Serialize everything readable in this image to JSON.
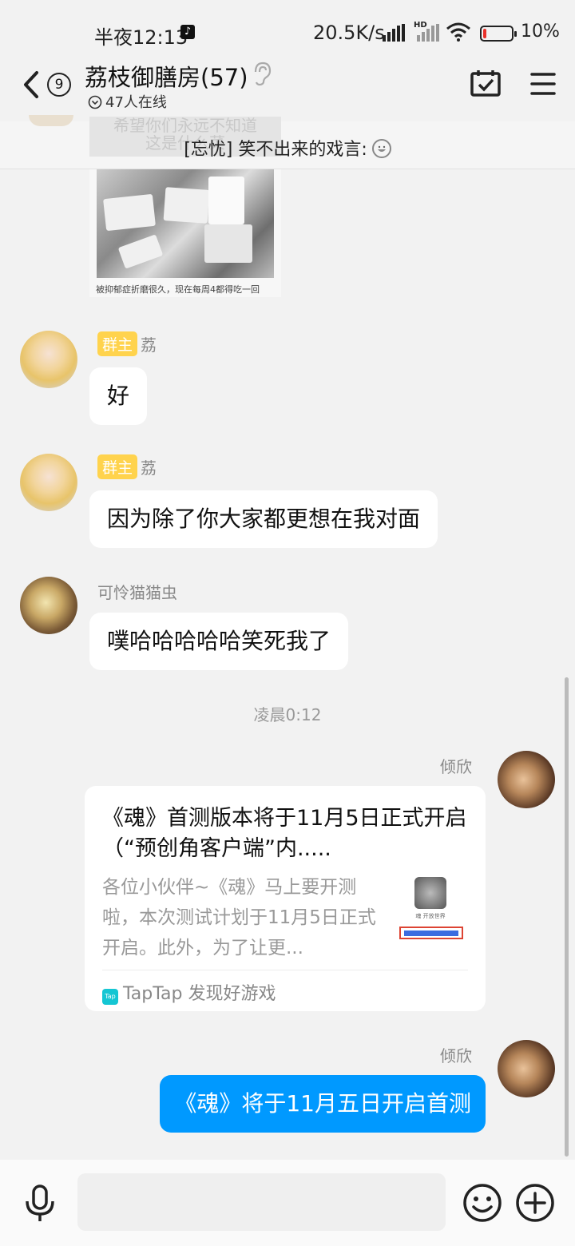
{
  "status_bar": {
    "time": "半夜12:13",
    "network_speed": "20.5K/s",
    "hd_label": "HD",
    "battery": "10%",
    "battery_level": 0.1
  },
  "header": {
    "back_count": "9",
    "group_name": "荔枝御膳房(57)",
    "online_count": "47人在线"
  },
  "pinned": {
    "text": "[忘忧] 笑不出来的戏言:",
    "ghost_text": "希望你们永远不知道\n这是什么菜"
  },
  "image_message": {
    "caption": "被抑郁症折磨很久，现在每周4都得吃一回"
  },
  "messages": [
    {
      "sender": "荔",
      "role": "群主",
      "text": "好"
    },
    {
      "sender": "荔",
      "role": "群主",
      "text": "因为除了你大家都更想在我对面"
    },
    {
      "sender": "可怜猫猫虫",
      "text": "噗哈哈哈哈哈笑死我了"
    }
  ],
  "timestamp": "凌晨0:12",
  "card_message": {
    "sender": "倾欣",
    "title": "《魂》首测版本将于11月5日正式开启（“预创角客户端”内.....",
    "description": "各位小伙伴~《魂》马上要开测啦，本次测试计划于11月5日正式开启。此外，为了让更...",
    "thumb_text": "魂 开放世界",
    "source_icon": "Tap",
    "source": "TapTap 发现好游戏"
  },
  "my_message": {
    "sender": "倾欣",
    "text": "《魂》将于11月五日开启首测"
  },
  "colors": {
    "accent": "#0099ff",
    "role_badge": "#ffd34d",
    "background": "#f2f2f2"
  }
}
